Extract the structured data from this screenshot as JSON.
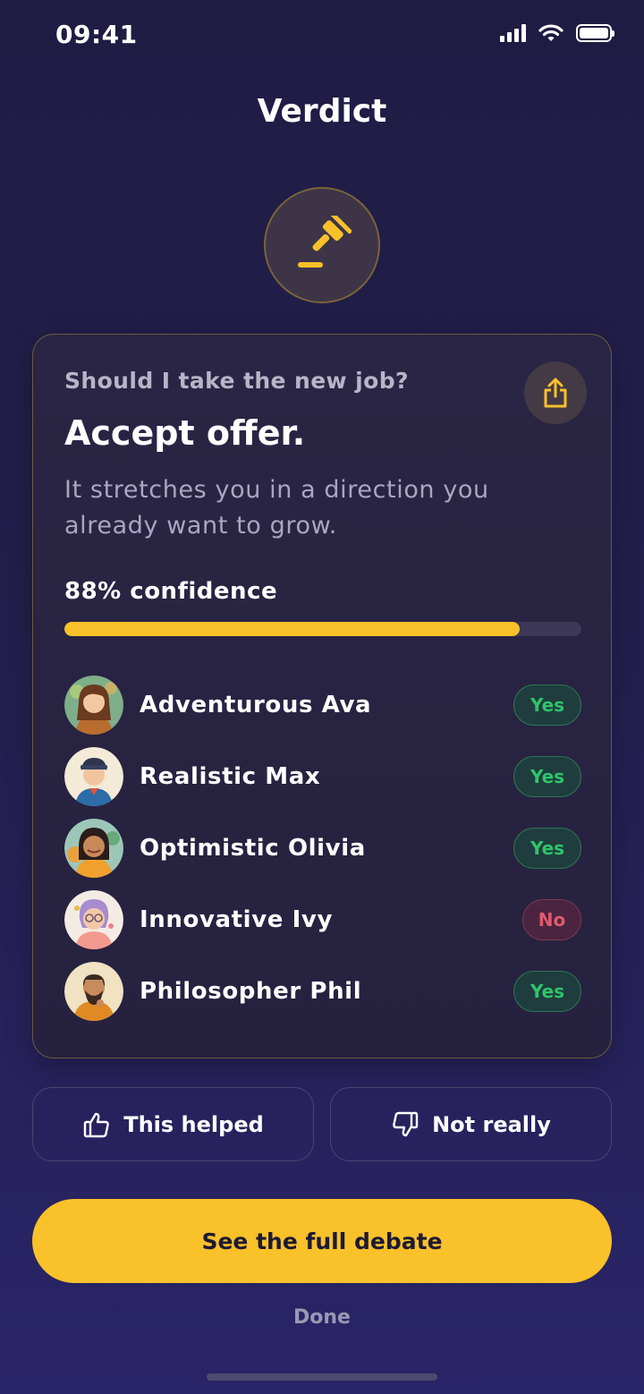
{
  "status_bar": {
    "time": "09:41"
  },
  "header": {
    "title": "Verdict"
  },
  "verdict_card": {
    "question": "Should I take the new job?",
    "verdict": "Accept offer.",
    "explanation": "It stretches you in a direction you already want to grow.",
    "confidence_label": "88% confidence",
    "confidence_value": 0.88,
    "voters": [
      {
        "name": "Adventurous Ava",
        "vote": "Yes"
      },
      {
        "name": "Realistic Max",
        "vote": "Yes"
      },
      {
        "name": "Optimistic Olivia",
        "vote": "Yes"
      },
      {
        "name": "Innovative Ivy",
        "vote": "No"
      },
      {
        "name": "Philosopher Phil",
        "vote": "Yes"
      }
    ]
  },
  "feedback": {
    "helped_label": "This helped",
    "not_really_label": "Not really"
  },
  "actions": {
    "primary_label": "See the full debate",
    "done_label": "Done"
  },
  "colors": {
    "accent": "#f9c12a",
    "background": "#221f4c",
    "yes": "#2fc46b",
    "no": "#e05a6e"
  },
  "icons": {
    "badge": "gavel-icon",
    "share": "share-icon",
    "helped": "thumbs-up-icon",
    "not_really": "thumbs-down-icon"
  }
}
